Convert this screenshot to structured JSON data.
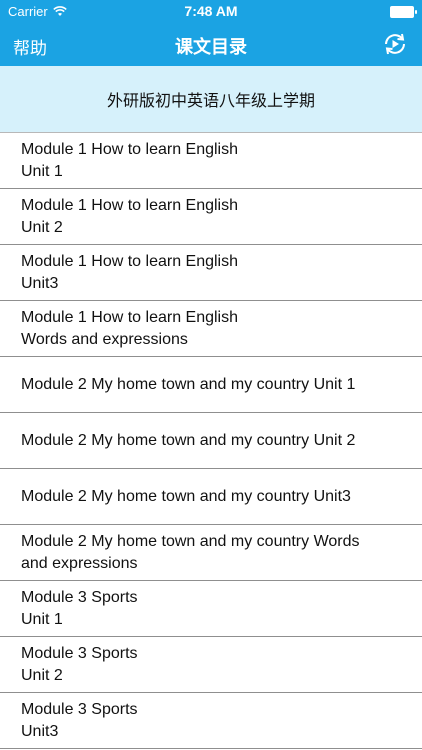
{
  "status": {
    "carrier": "Carrier",
    "time": "7:48 AM"
  },
  "nav": {
    "left_label": "帮助",
    "title": "课文目录",
    "right_icon": "refresh-play-icon"
  },
  "header": {
    "title": "外研版初中英语八年级上学期"
  },
  "items": [
    {
      "line1": "Module 1 How to learn English",
      "line2": "Unit 1"
    },
    {
      "line1": "Module 1 How to learn English",
      "line2": "Unit 2"
    },
    {
      "line1": "Module 1 How to learn English",
      "line2": "Unit3"
    },
    {
      "line1": "Module 1 How to learn English",
      "line2": "Words and expressions"
    },
    {
      "line1": "Module 2 My home town and my country  Unit 1",
      "line2": ""
    },
    {
      "line1": "Module 2 My home town and my country  Unit 2",
      "line2": ""
    },
    {
      "line1": "Module 2 My home town and my country  Unit3",
      "line2": ""
    },
    {
      "line1": "Module 2 My home town and my country  Words",
      "line2": "and expressions"
    },
    {
      "line1": "Module 3 Sports",
      "line2": "Unit 1"
    },
    {
      "line1": "Module 3 Sports",
      "line2": "Unit 2"
    },
    {
      "line1": "Module 3 Sports",
      "line2": "Unit3"
    }
  ],
  "colors": {
    "accent": "#1ba3e3",
    "banner": "#d6f1fb"
  }
}
